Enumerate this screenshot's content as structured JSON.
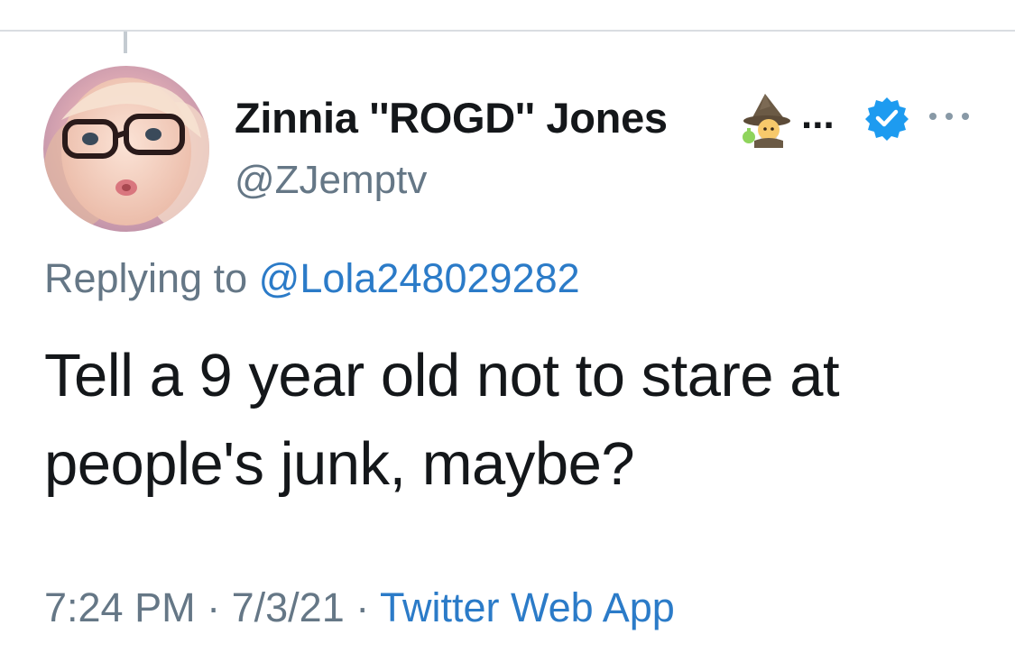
{
  "tweet": {
    "display_name": "Zinnia ''ROGD'' Jones",
    "name_truncation": "...",
    "handle": "@ZJemptv",
    "reply_prefix": "Replying to",
    "reply_to_handle": "@Lola248029282",
    "text_line1": "Tell a 9 year old not to stare at",
    "text_line2": "people's junk, maybe?",
    "time": "7:24 PM",
    "separator": "·",
    "date": "7/3/21",
    "source": "Twitter Web App",
    "verified": true,
    "name_emoji": "mage-emoji"
  },
  "icons": {
    "avatar": "profile-photo",
    "verified": "verified-badge-icon",
    "more": "more-options-icon",
    "emoji": "mage-emoji-icon"
  },
  "colors": {
    "text_primary": "#14171a",
    "text_secondary": "#657786",
    "link": "#2b7bc8",
    "verified_blue": "#1d9bf0",
    "divider": "#d9dde1"
  }
}
